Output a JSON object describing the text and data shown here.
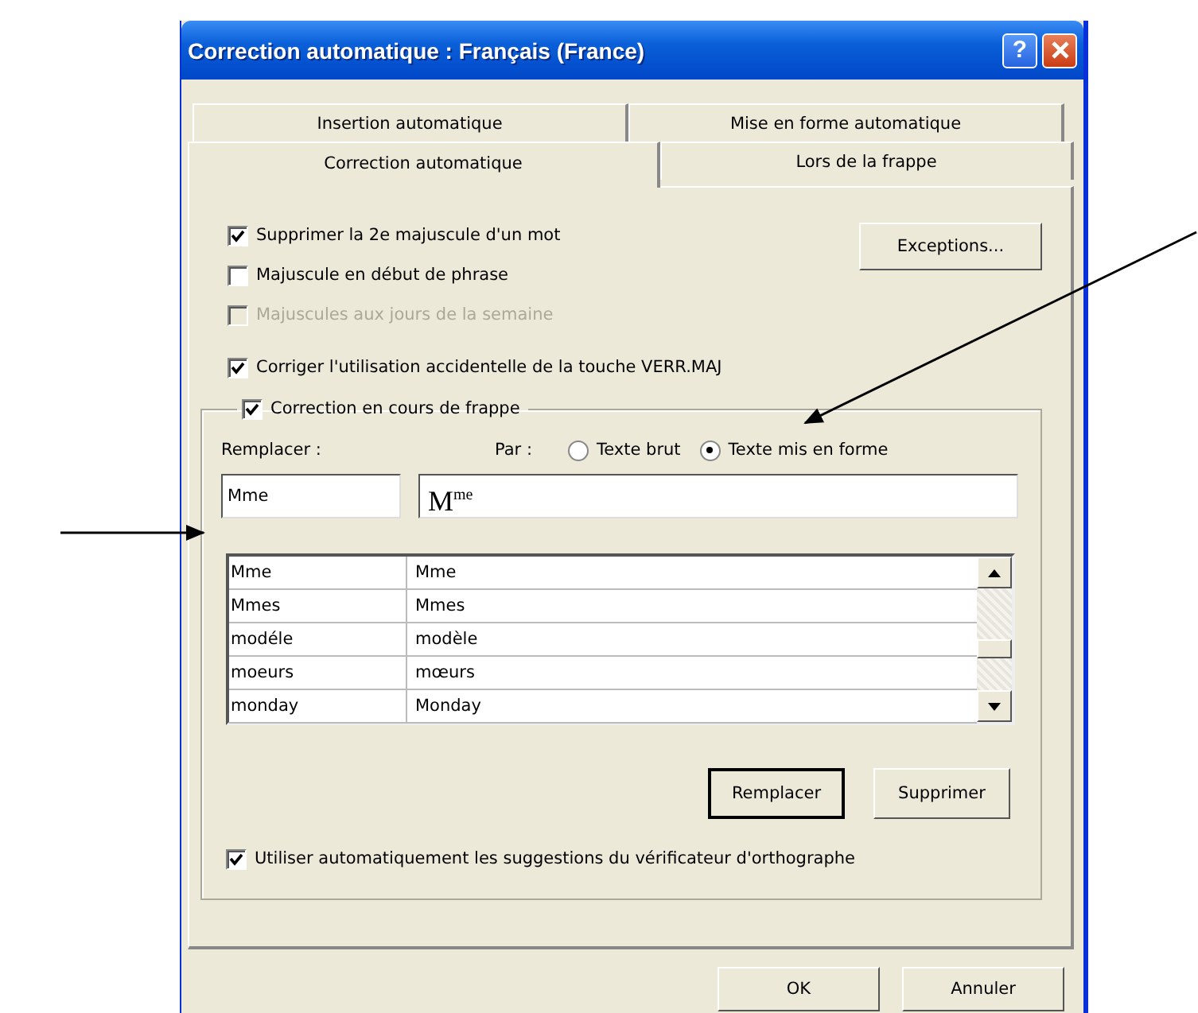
{
  "window": {
    "title": "Correction automatique : Français (France)",
    "help": "?"
  },
  "tabs": [
    [
      {
        "label": "Insertion automatique",
        "selected": false
      },
      {
        "label": "Mise en forme automatique",
        "selected": false
      }
    ],
    [
      {
        "label": "Correction automatique",
        "selected": true
      },
      {
        "label": "Lors de la frappe",
        "selected": false
      }
    ]
  ],
  "options": [
    {
      "label": "Supprimer la 2e majuscule d'un mot",
      "checked": true,
      "disabled": false
    },
    {
      "label": "Majuscule en début de phrase",
      "checked": false,
      "disabled": false
    },
    {
      "label": "Majuscules aux jours de la semaine",
      "checked": false,
      "disabled": true
    },
    {
      "label": "Corriger l'utilisation accidentelle de la touche VERR.MAJ",
      "checked": true,
      "disabled": false
    }
  ],
  "exceptions_button": "Exceptions...",
  "group": {
    "label": "Correction en cours de frappe",
    "checked": true,
    "replace_label": "Remplacer :",
    "by_label": "Par :",
    "radios": [
      {
        "label": "Texte brut",
        "selected": false
      },
      {
        "label": "Texte mis en forme",
        "selected": true
      }
    ],
    "replace_value": "Mme",
    "with_value": "M$^{me}$",
    "rows": [
      [
        "Mme",
        "Mme"
      ],
      [
        "Mmes",
        "Mmes"
      ],
      [
        "modéle",
        "modèle"
      ],
      [
        "moeurs",
        "mœurs"
      ],
      [
        "monday",
        "Monday"
      ]
    ],
    "buttons": [
      {
        "label": "Remplacer",
        "default": true
      },
      {
        "label": "Supprimer",
        "default": false
      }
    ],
    "suggest": {
      "label": "Utiliser automatiquement les suggestions du vérificateur d'orthographe",
      "checked": true
    }
  },
  "footer_buttons": [
    "OK",
    "Annuler"
  ]
}
